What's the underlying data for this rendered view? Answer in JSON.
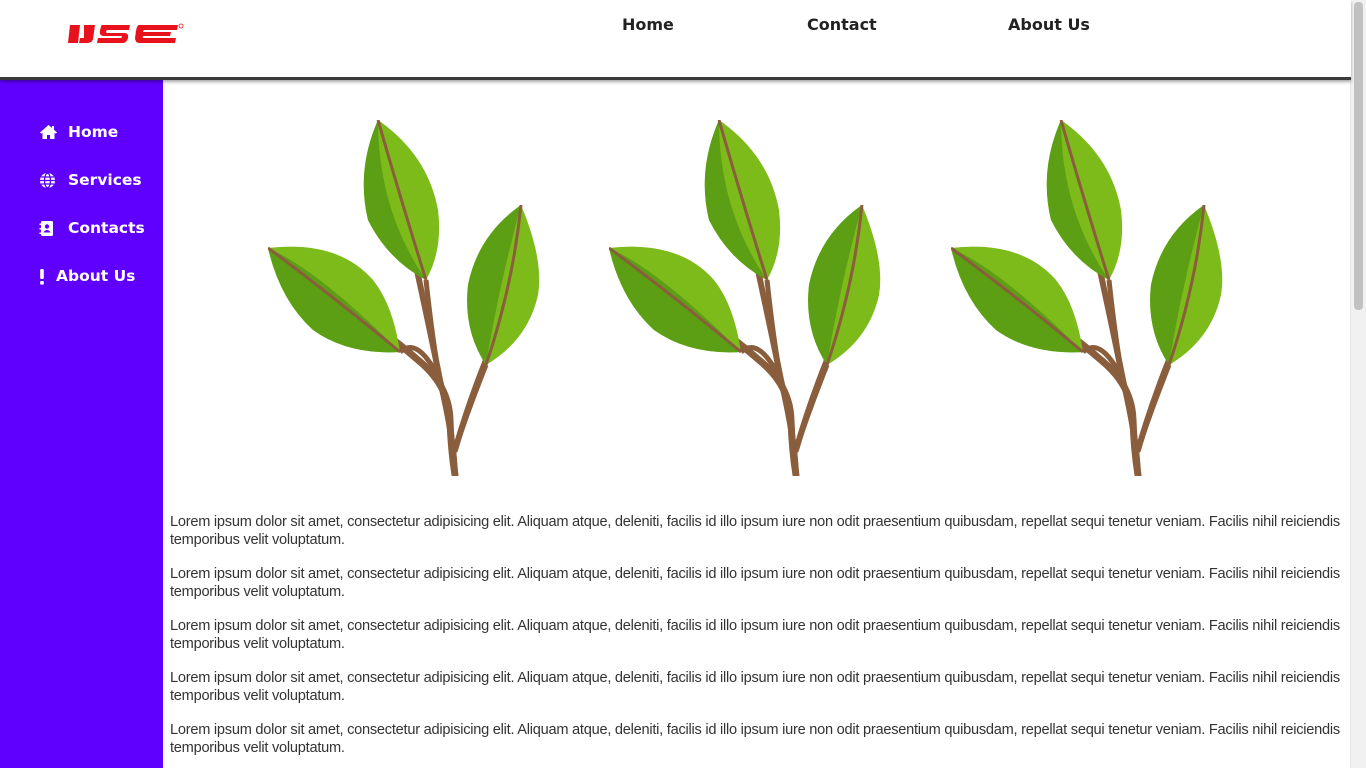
{
  "header": {
    "logo_text": "IJSE",
    "nav": [
      {
        "label": "Home"
      },
      {
        "label": "Contact"
      },
      {
        "label": "About Us"
      }
    ]
  },
  "sidebar": {
    "items": [
      {
        "label": "Home",
        "icon": "home-icon"
      },
      {
        "label": "Services",
        "icon": "globe-icon"
      },
      {
        "label": "Contacts",
        "icon": "contact-card-icon"
      },
      {
        "label": "About Us",
        "icon": "exclamation-icon"
      }
    ]
  },
  "main": {
    "images": [
      {
        "icon": "plant-sprout-image"
      },
      {
        "icon": "plant-sprout-image"
      },
      {
        "icon": "plant-sprout-image"
      }
    ],
    "paragraphs": [
      "Lorem ipsum dolor sit amet, consectetur adipisicing elit. Aliquam atque, deleniti, facilis id illo ipsum iure non odit praesentium quibusdam, repellat sequi tenetur veniam. Facilis nihil reiciendis temporibus velit voluptatum.",
      "Lorem ipsum dolor sit amet, consectetur adipisicing elit. Aliquam atque, deleniti, facilis id illo ipsum iure non odit praesentium quibusdam, repellat sequi tenetur veniam. Facilis nihil reiciendis temporibus velit voluptatum.",
      "Lorem ipsum dolor sit amet, consectetur adipisicing elit. Aliquam atque, deleniti, facilis id illo ipsum iure non odit praesentium quibusdam, repellat sequi tenetur veniam. Facilis nihil reiciendis temporibus velit voluptatum.",
      "Lorem ipsum dolor sit amet, consectetur adipisicing elit. Aliquam atque, deleniti, facilis id illo ipsum iure non odit praesentium quibusdam, repellat sequi tenetur veniam. Facilis nihil reiciendis temporibus velit voluptatum.",
      "Lorem ipsum dolor sit amet, consectetur adipisicing elit. Aliquam atque, deleniti, facilis id illo ipsum iure non odit praesentium quibusdam, repellat sequi tenetur veniam. Facilis nihil reiciendis temporibus velit voluptatum."
    ]
  },
  "colors": {
    "sidebar_bg": "#5f00ff",
    "logo_red": "#e8121c",
    "leaf_light": "#7dbb1a",
    "leaf_dark": "#5c9e14",
    "stem": "#8a5e3c"
  }
}
